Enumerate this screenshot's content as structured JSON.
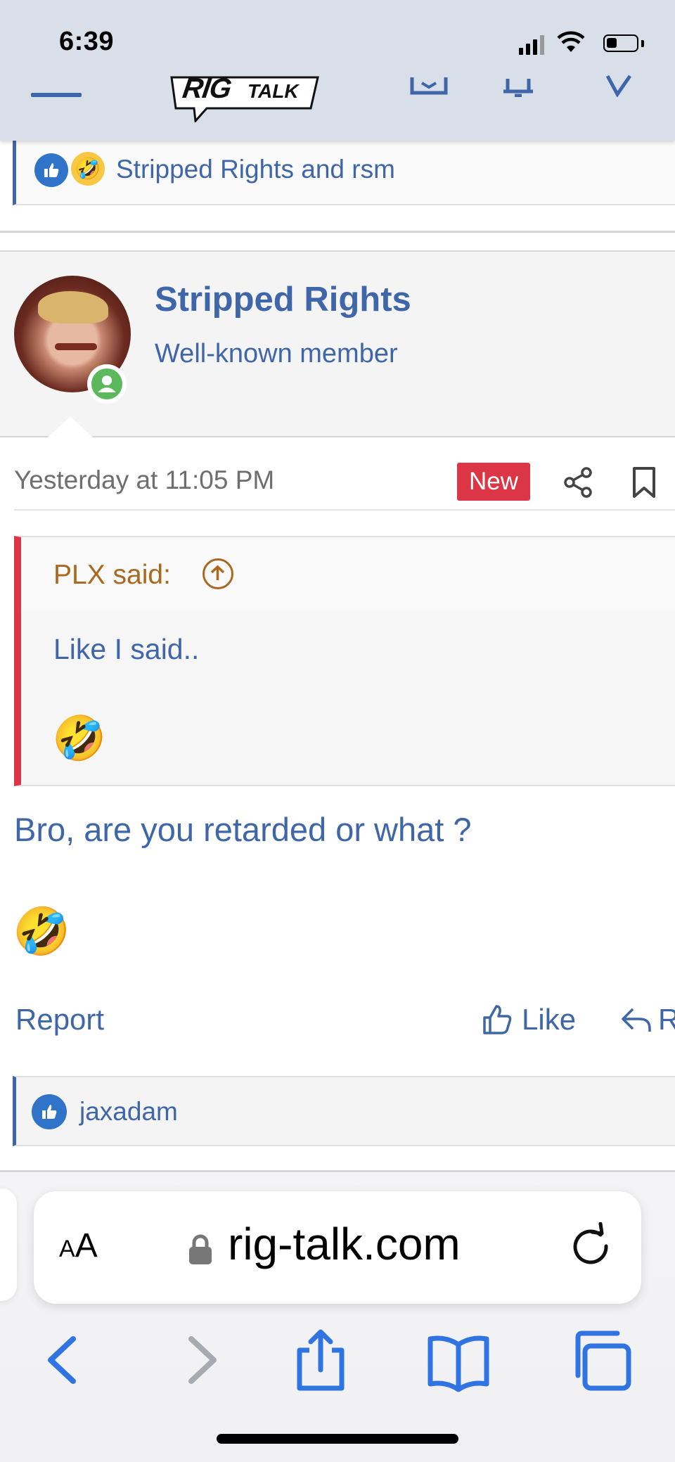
{
  "status_bar": {
    "time": "6:39"
  },
  "nav": {
    "logo_text": "RIG",
    "logo_sub": "TALK"
  },
  "reactions_top": {
    "text": "Stripped Rights and rsm"
  },
  "post": {
    "username": "Stripped Rights",
    "user_title": "Well-known member",
    "date": "Yesterday at 11:05 PM",
    "new_badge": "New",
    "quote": {
      "author": "PLX said:",
      "body": "Like I said..",
      "emoji": "🤣"
    },
    "message": "Bro, are you retarded or what ?",
    "message_emoji": "🤣",
    "actions": {
      "report": "Report",
      "like": "Like",
      "reply": "Reply"
    }
  },
  "reactions_bottom": {
    "text": "jaxadam"
  },
  "safari": {
    "aa_small": "A",
    "aa_big": "A",
    "url": "rig-talk.com"
  },
  "colors": {
    "link": "#3f66a8",
    "quote_author": "#a9691e",
    "new_badge": "#dc3545",
    "online": "#5cb85c",
    "safari_blue": "#2f74e0"
  }
}
